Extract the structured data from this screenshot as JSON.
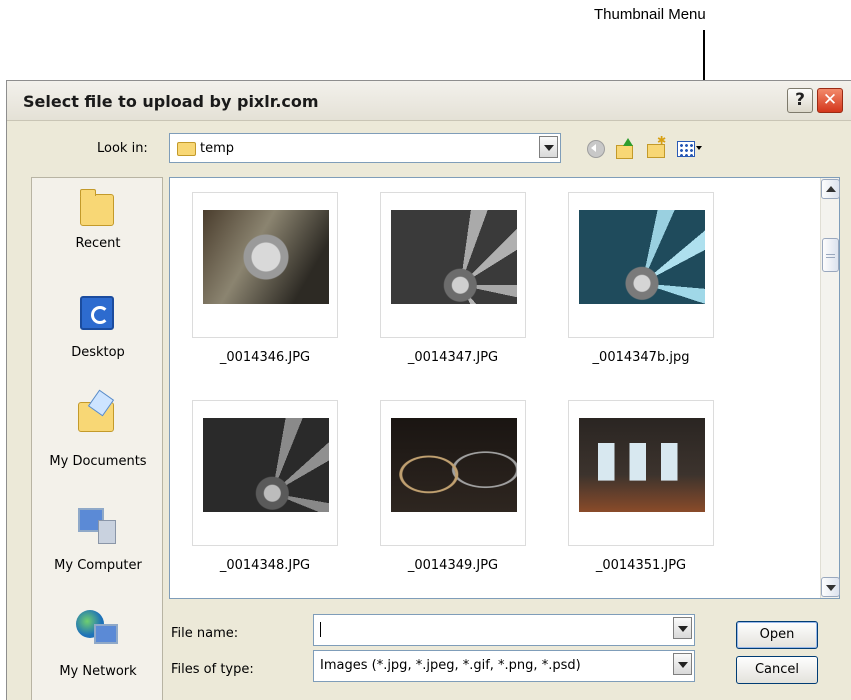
{
  "annotation": {
    "label": "Thumbnail Menu"
  },
  "dialog": {
    "title": "Select file to upload by pixlr.com",
    "help_label": "?",
    "close_label": "✕"
  },
  "toolbar": {
    "look_in_label": "Look in:",
    "look_in_value": "temp",
    "icons": [
      "back-icon",
      "up-folder-icon",
      "new-folder-icon",
      "views-menu-icon"
    ]
  },
  "places": [
    {
      "label": "Recent",
      "icon": "recent-folder-icon"
    },
    {
      "label": "Desktop",
      "icon": "desktop-icon"
    },
    {
      "label": "My Documents",
      "icon": "my-documents-icon"
    },
    {
      "label": "My Computer",
      "icon": "my-computer-icon"
    },
    {
      "label": "My Network",
      "icon": "my-network-icon"
    }
  ],
  "files": [
    {
      "name": "_0014346.JPG"
    },
    {
      "name": "_0014347.JPG"
    },
    {
      "name": "_0014347b.jpg"
    },
    {
      "name": "_0014348.JPG"
    },
    {
      "name": "_0014349.JPG"
    },
    {
      "name": "_0014351.JPG"
    }
  ],
  "form": {
    "file_name_label": "File name:",
    "file_name_value": "",
    "file_type_label": "Files of type:",
    "file_type_value": "Images (*.jpg, *.jpeg, *.gif, *.png, *.psd)"
  },
  "buttons": {
    "open": "Open",
    "cancel": "Cancel"
  }
}
